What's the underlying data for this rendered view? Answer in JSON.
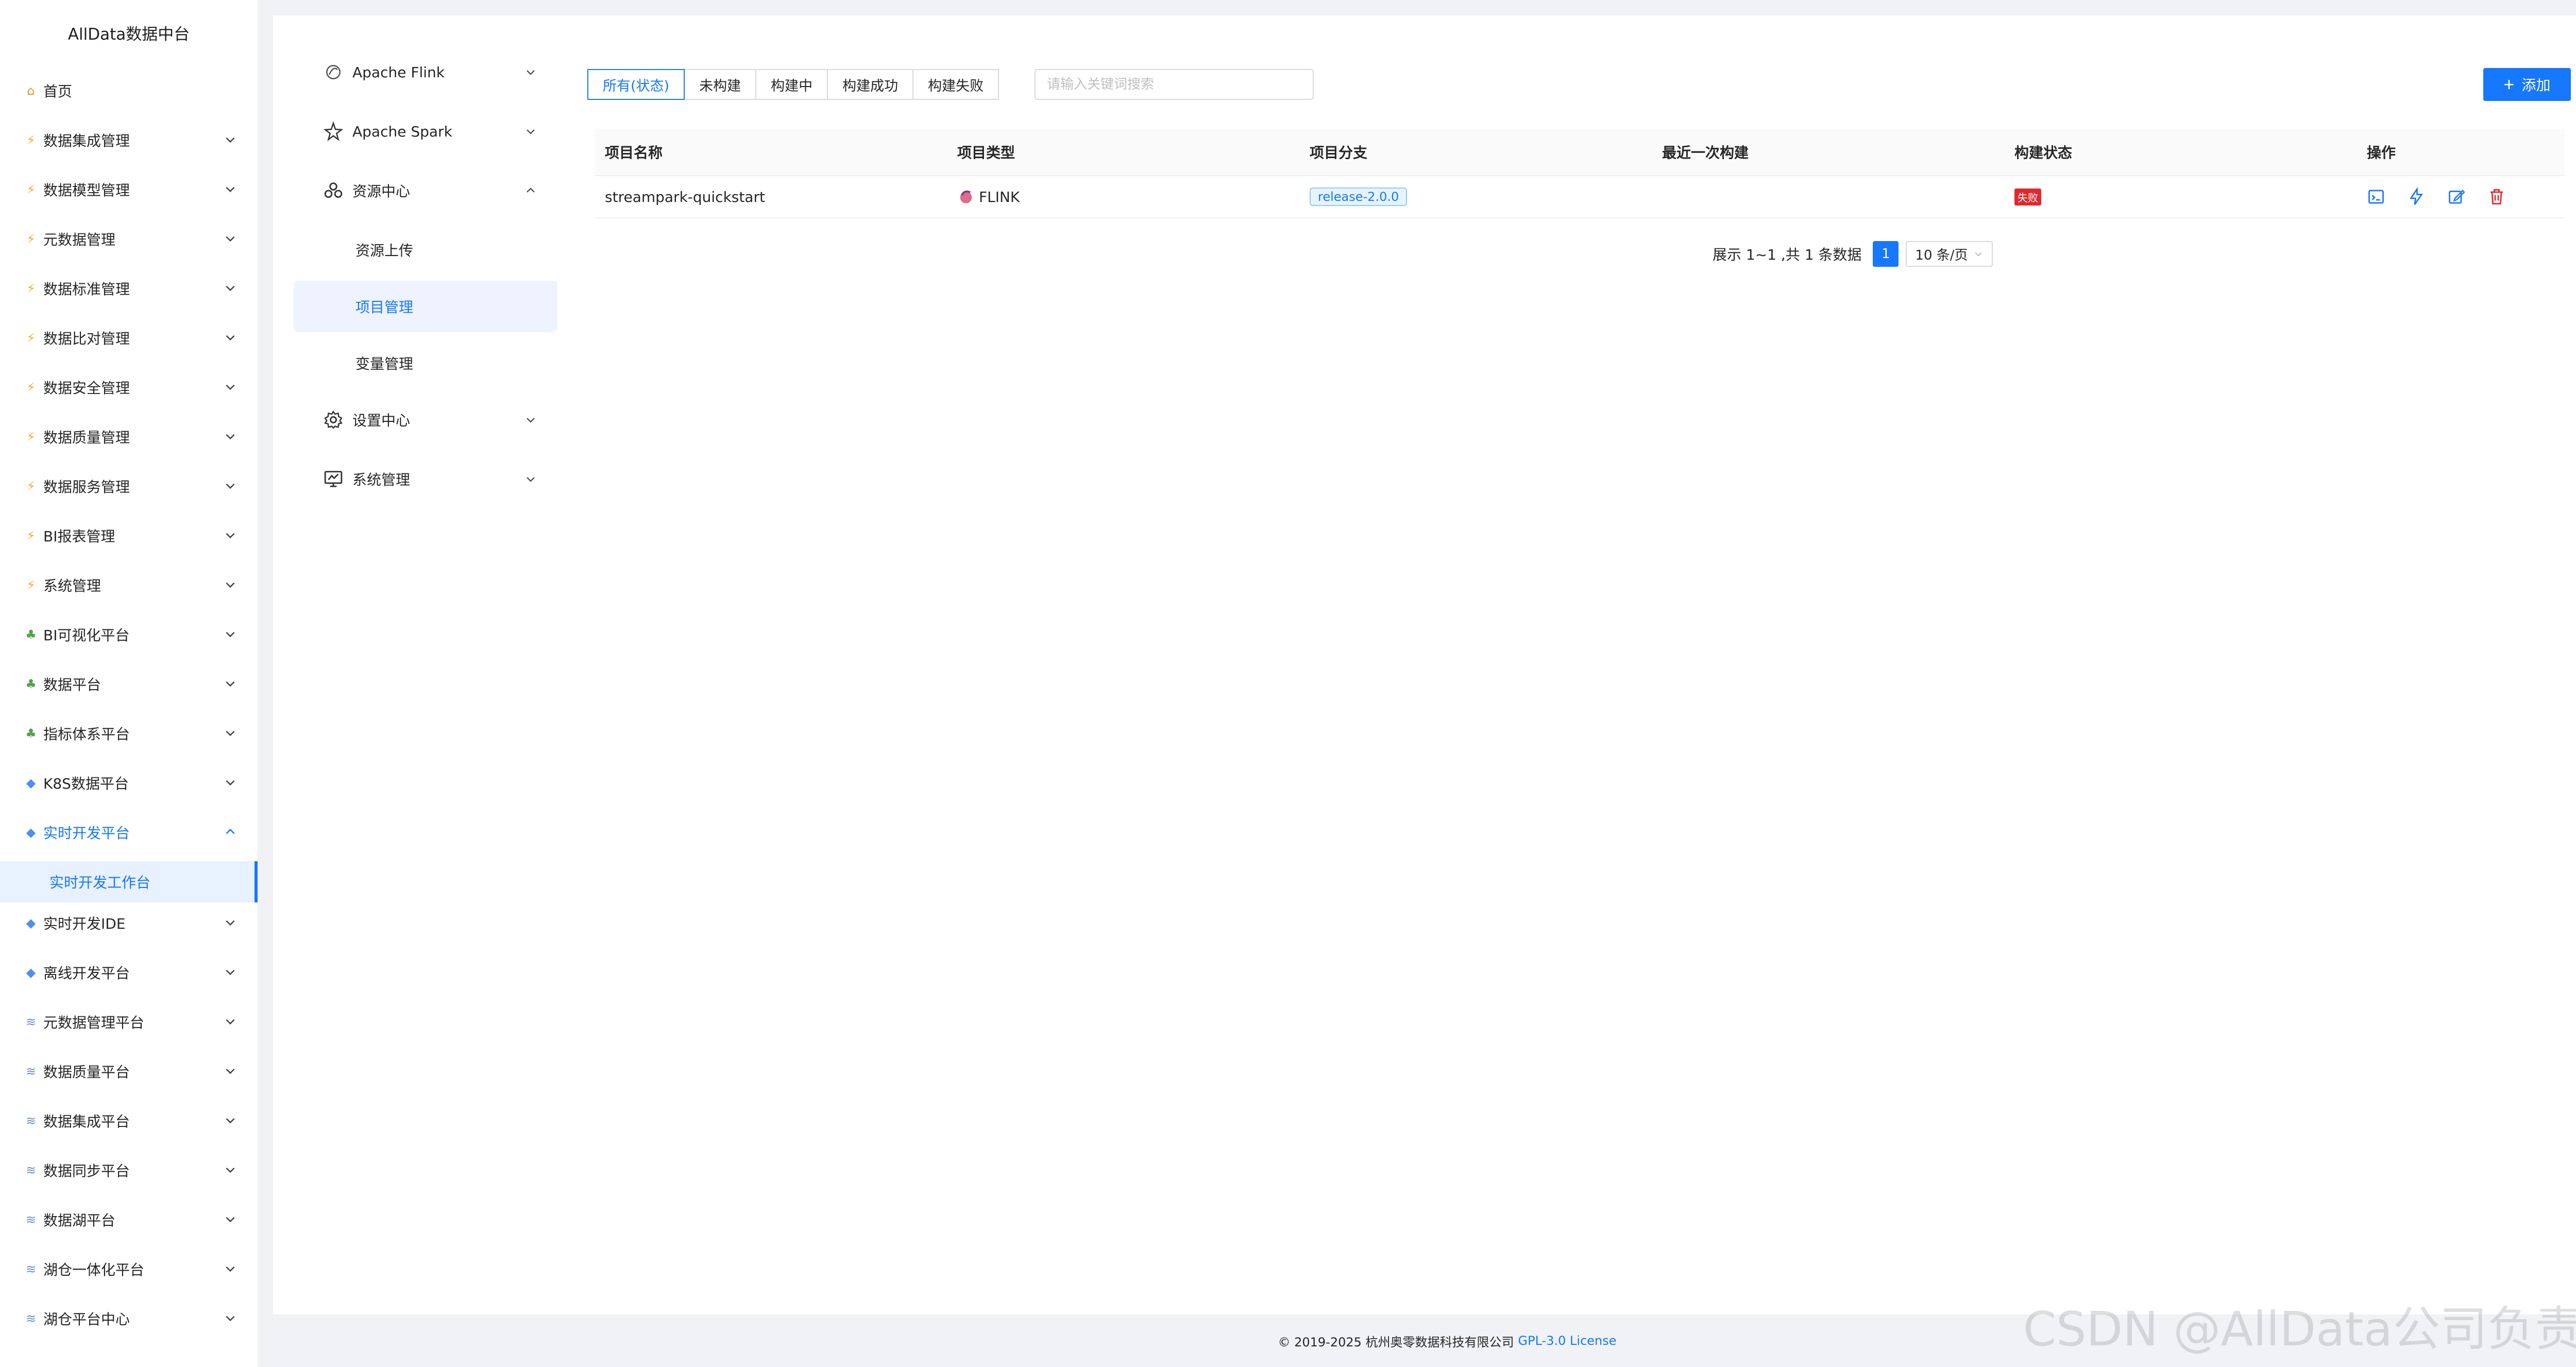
{
  "brand": "AllData数据中台",
  "sidebar": {
    "home": "首页",
    "items": [
      {
        "label": "数据集成管理",
        "icon": "bolt-icon"
      },
      {
        "label": "数据模型管理",
        "icon": "bolt-icon"
      },
      {
        "label": "元数据管理",
        "icon": "bolt-icon"
      },
      {
        "label": "数据标准管理",
        "icon": "bolt-icon"
      },
      {
        "label": "数据比对管理",
        "icon": "bolt-icon"
      },
      {
        "label": "数据安全管理",
        "icon": "bolt-icon"
      },
      {
        "label": "数据质量管理",
        "icon": "bolt-icon"
      },
      {
        "label": "数据服务管理",
        "icon": "bolt-icon"
      },
      {
        "label": "BI报表管理",
        "icon": "bolt-icon"
      },
      {
        "label": "系统管理",
        "icon": "bolt-icon"
      },
      {
        "label": "BI可视化平台",
        "icon": "leaf-icon"
      },
      {
        "label": "数据平台",
        "icon": "leaf-icon"
      },
      {
        "label": "指标体系平台",
        "icon": "leaf-icon"
      },
      {
        "label": "K8S数据平台",
        "icon": "gem-icon"
      },
      {
        "label": "实时开发平台",
        "icon": "gem-icon"
      },
      {
        "label": "实时开发IDE",
        "icon": "gem-icon"
      },
      {
        "label": "离线开发平台",
        "icon": "gem-icon"
      },
      {
        "label": "元数据管理平台",
        "icon": "database-icon"
      },
      {
        "label": "数据质量平台",
        "icon": "database-icon"
      },
      {
        "label": "数据集成平台",
        "icon": "database-icon"
      },
      {
        "label": "数据同步平台",
        "icon": "database-icon"
      },
      {
        "label": "数据湖平台",
        "icon": "database-icon"
      },
      {
        "label": "湖仓一体化平台",
        "icon": "database-icon"
      },
      {
        "label": "湖仓平台中心",
        "icon": "database-icon"
      }
    ],
    "active_sub": "实时开发工作台"
  },
  "submenu": {
    "flink": "Apache Flink",
    "spark": "Apache Spark",
    "resource": "资源中心",
    "resource_upload": "资源上传",
    "project": "项目管理",
    "variable": "变量管理",
    "settings": "设置中心",
    "system": "系统管理"
  },
  "filters": [
    "所有(状态)",
    "未构建",
    "构建中",
    "构建成功",
    "构建失败"
  ],
  "search": {
    "placeholder": "请输入关键词搜索"
  },
  "add_label": "添加",
  "table": {
    "headers": [
      "项目名称",
      "项目类型",
      "项目分支",
      "最近一次构建",
      "构建状态",
      "操作"
    ],
    "rows": [
      {
        "name": "streampark-quickstart",
        "type": "FLINK",
        "branch": "release-2.0.0",
        "last_build": "",
        "status": "失败"
      }
    ]
  },
  "pager": {
    "summary": "展示 1~1 ,共 1 条数据",
    "page": "1",
    "size": "10 条/页"
  },
  "footer": {
    "copyright": "© 2019-2025 杭州奥零数据科技有限公司",
    "license": "GPL-3.0 License"
  },
  "watermark": "CSDN @AllData公司负责人",
  "colors": {
    "accent": "#1677ff",
    "danger": "#e0282e"
  }
}
